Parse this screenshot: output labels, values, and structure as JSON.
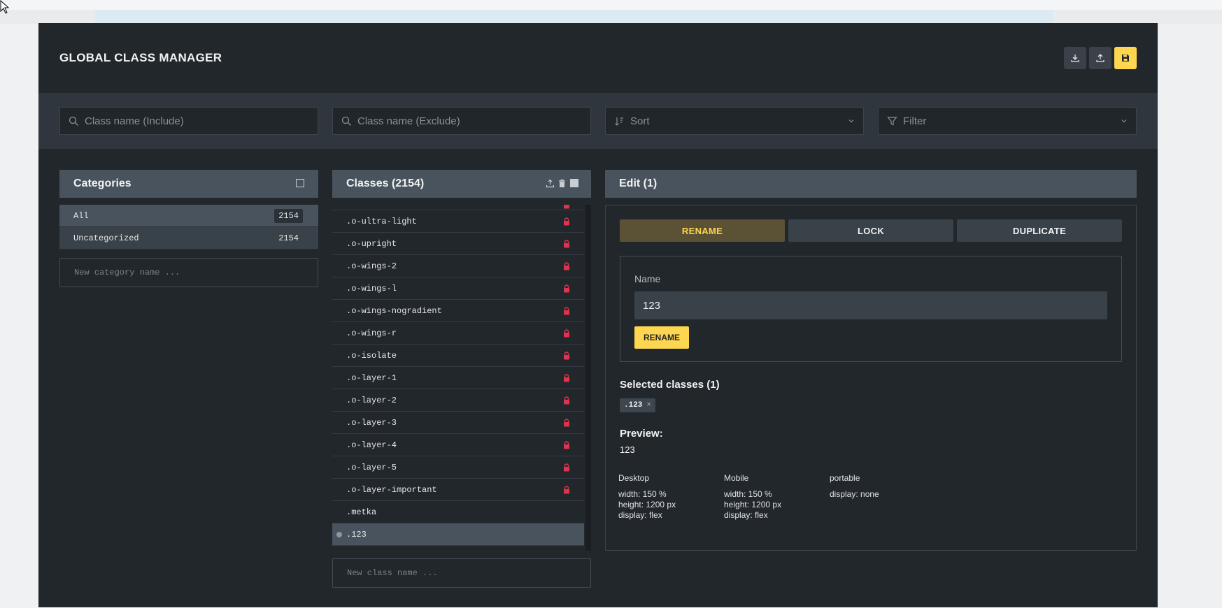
{
  "modal": {
    "title": "GLOBAL CLASS MANAGER",
    "header_buttons": [
      "download-icon",
      "upload-icon",
      "save-icon"
    ]
  },
  "filters": {
    "include_placeholder": "Class name (Include)",
    "exclude_placeholder": "Class name (Exclude)",
    "sort_label": "Sort",
    "filter_label": "Filter"
  },
  "categories": {
    "title": "Categories",
    "items": [
      {
        "label": "All",
        "count": "2154"
      },
      {
        "label": "Uncategorized",
        "count": "2154"
      }
    ],
    "new_placeholder": "New category name ..."
  },
  "classes": {
    "title": "Classes (2154)",
    "items": [
      {
        "name": ".o-ultra-light",
        "locked": true
      },
      {
        "name": ".o-upright",
        "locked": true
      },
      {
        "name": ".o-wings-2",
        "locked": true
      },
      {
        "name": ".o-wings-l",
        "locked": true
      },
      {
        "name": ".o-wings-nogradient",
        "locked": true
      },
      {
        "name": ".o-wings-r",
        "locked": true
      },
      {
        "name": ".o-isolate",
        "locked": true
      },
      {
        "name": ".o-layer-1",
        "locked": true
      },
      {
        "name": ".o-layer-2",
        "locked": true
      },
      {
        "name": ".o-layer-3",
        "locked": true
      },
      {
        "name": ".o-layer-4",
        "locked": true
      },
      {
        "name": ".o-layer-5",
        "locked": true
      },
      {
        "name": ".o-layer-important",
        "locked": true
      },
      {
        "name": ".metka",
        "locked": false
      },
      {
        "name": ".123",
        "locked": false,
        "selected": true
      }
    ],
    "new_placeholder": "New class name ..."
  },
  "edit": {
    "title": "Edit (1)",
    "tabs": [
      "RENAME",
      "LOCK",
      "DUPLICATE"
    ],
    "active_tab": "RENAME",
    "name_label": "Name",
    "name_value": "123",
    "rename_button": "RENAME",
    "selected_title": "Selected classes (1)",
    "selected_chip": ".123",
    "preview_title": "Preview:",
    "preview_value": "123",
    "breakpoints": [
      {
        "name": "Desktop",
        "props": [
          "width: 150 %",
          "height: 1200 px",
          "display: flex"
        ]
      },
      {
        "name": "Mobile",
        "props": [
          "width: 150 %",
          "height: 1200 px",
          "display: flex"
        ]
      },
      {
        "name": "portable",
        "props": [
          "display: none"
        ]
      }
    ]
  },
  "colors": {
    "accent": "#ffd64f",
    "lock": "#e0334d",
    "modal_bg": "#22272c",
    "panel_header": "#48535d"
  }
}
